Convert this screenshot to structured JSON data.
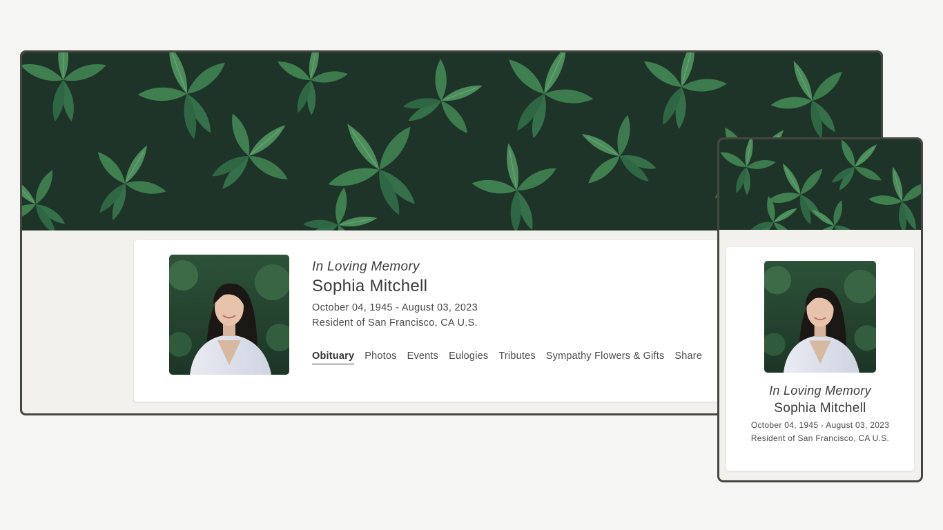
{
  "profile": {
    "memory_label": "In Loving Memory",
    "name": "Sophia Mitchell",
    "dates": "October 04, 1945 - August 03, 2023",
    "residence": "Resident of San Francisco, CA U.S."
  },
  "tabs": [
    {
      "label": "Obituary",
      "active": true
    },
    {
      "label": "Photos",
      "active": false
    },
    {
      "label": "Events",
      "active": false
    },
    {
      "label": "Eulogies",
      "active": false
    },
    {
      "label": "Tributes",
      "active": false
    },
    {
      "label": "Sympathy Flowers & Gifts",
      "active": false
    },
    {
      "label": "Share",
      "active": false
    }
  ],
  "images": {
    "banner": "leaf-foliage-banner",
    "portrait": "profile-photo"
  },
  "colors": {
    "frame_border": "#45463f",
    "page_background": "#f5f5f4",
    "content_background": "#f2f1ee",
    "card": "#ffffff",
    "foliage_dark": "#1f3a2c",
    "foliage_light": "#5ea06b"
  }
}
